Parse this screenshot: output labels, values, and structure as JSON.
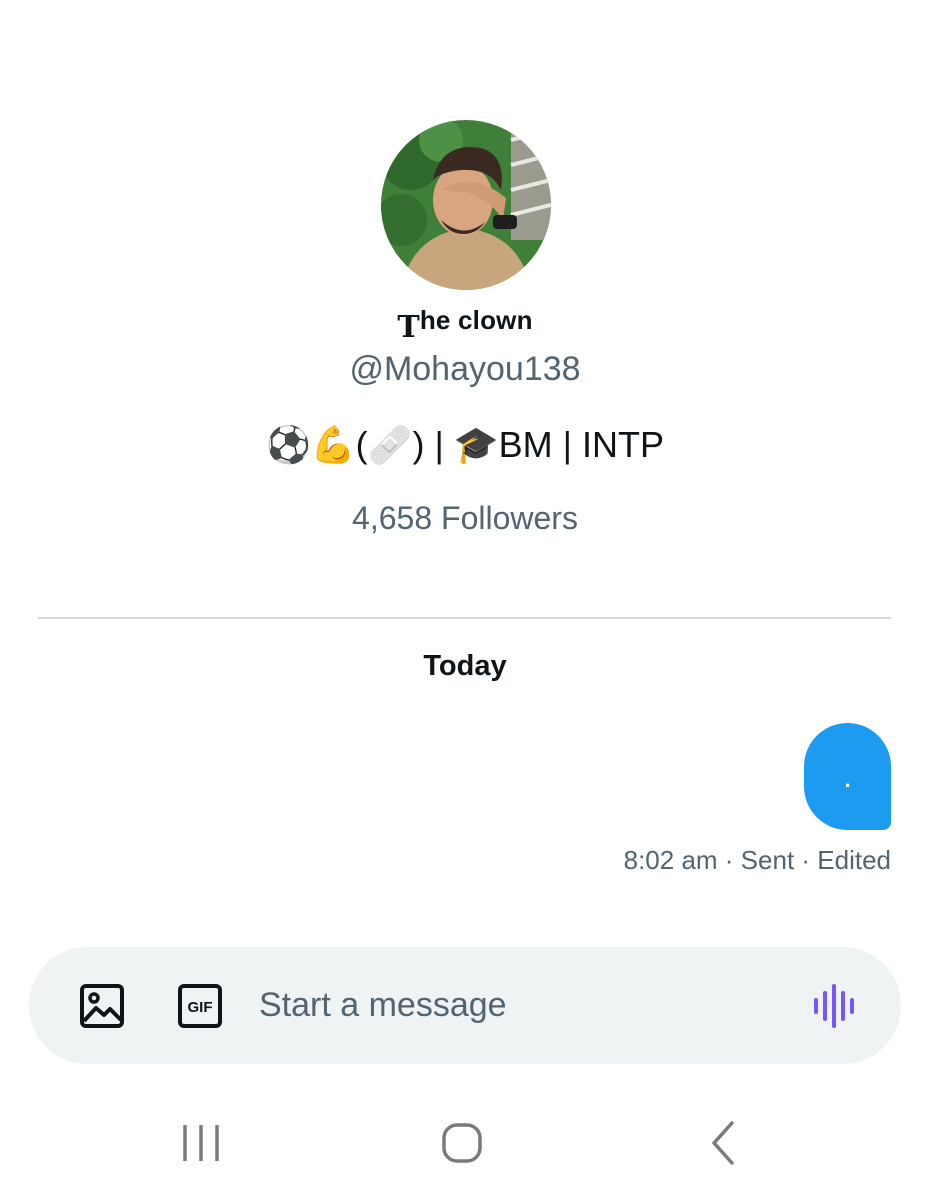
{
  "profile": {
    "avatar_alt": "avatar",
    "name_cap": "T",
    "name_rest": "he clown",
    "handle": "@Mohayou138",
    "bio": "⚽💪(🩹) | 🎓BM | INTP",
    "followers": "4,658 Followers"
  },
  "conversation": {
    "day_label": "Today",
    "messages": [
      {
        "text": ".",
        "direction": "outgoing",
        "meta": "8:02 am · Sent · Edited"
      }
    ]
  },
  "composer": {
    "placeholder": "Start a message",
    "media_icon": "image-icon",
    "gif_icon": "gif-icon",
    "gif_label": "GIF",
    "voice_icon": "voice-waveform-icon"
  },
  "system_nav": {
    "recents_icon": "recents-icon",
    "home_icon": "home-icon",
    "back_icon": "back-icon"
  },
  "colors": {
    "accent": "#1d9bf0",
    "secondary_text": "#536471",
    "composer_bg": "#eff3f4",
    "voice_accent": "#7856ff",
    "divider": "#cfd9de"
  }
}
